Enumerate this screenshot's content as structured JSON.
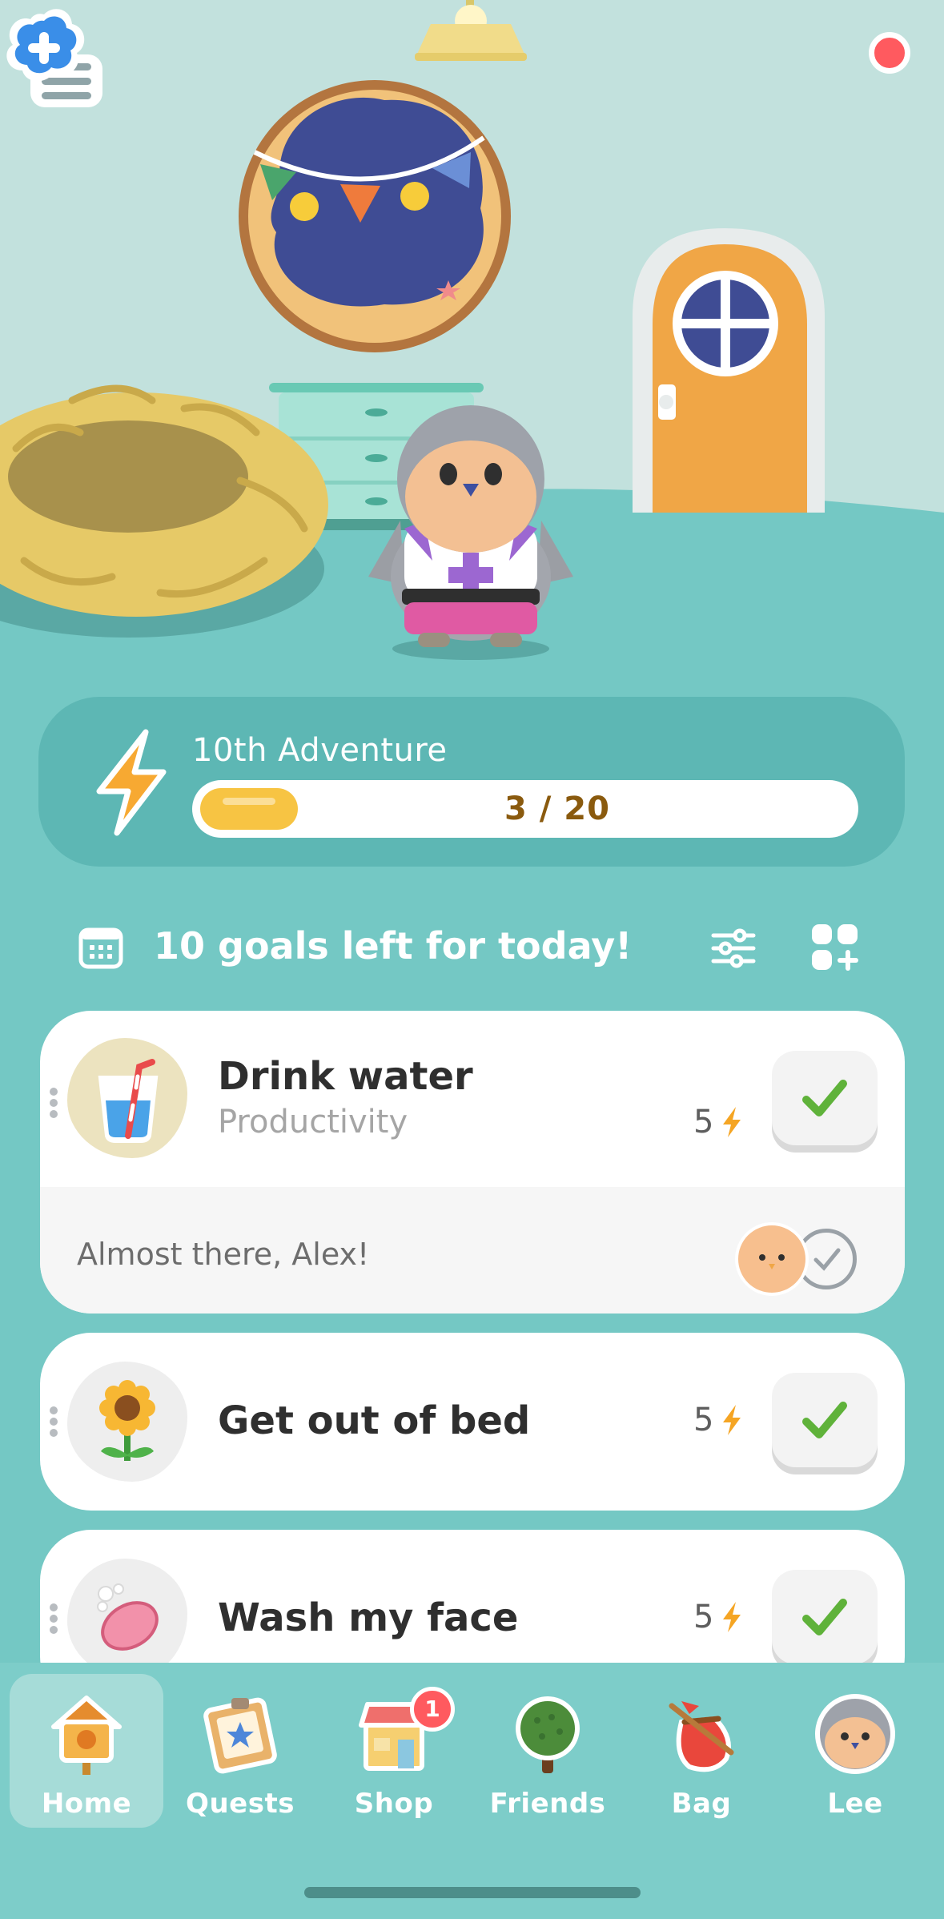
{
  "header": {
    "menu_icon": "hamburger-menu-icon",
    "add_friend_icon": "add-friend-plus-icon"
  },
  "adventure": {
    "title": "10th Adventure",
    "progress_text": "3 / 20",
    "progress": 0.15,
    "icon": "energy-bolt-icon"
  },
  "goals": {
    "left_text": "10 goals left for today!",
    "items": [
      {
        "name": "Drink water",
        "category": "Productivity",
        "energy": "5",
        "icon": "water-glass-icon",
        "comment": "Almost there, Alex!"
      },
      {
        "name": "Get out of bed",
        "category": "",
        "energy": "5",
        "icon": "sunflower-icon"
      },
      {
        "name": "Wash my face",
        "category": "",
        "energy": "5",
        "icon": "soap-icon"
      }
    ]
  },
  "nav": {
    "items": [
      {
        "label": "Home",
        "icon": "birdhouse-icon",
        "active": true
      },
      {
        "label": "Quests",
        "icon": "quest-board-icon"
      },
      {
        "label": "Shop",
        "icon": "shop-icon",
        "badge": "1"
      },
      {
        "label": "Friends",
        "icon": "tree-icon"
      },
      {
        "label": "Bag",
        "icon": "bag-icon"
      },
      {
        "label": "Lee",
        "icon": "bird-avatar-icon"
      }
    ]
  },
  "colors": {
    "background": "#74c8c4",
    "accent_yellow": "#f7c443",
    "check_green": "#5fb23a",
    "energy_orange": "#f5a524"
  }
}
